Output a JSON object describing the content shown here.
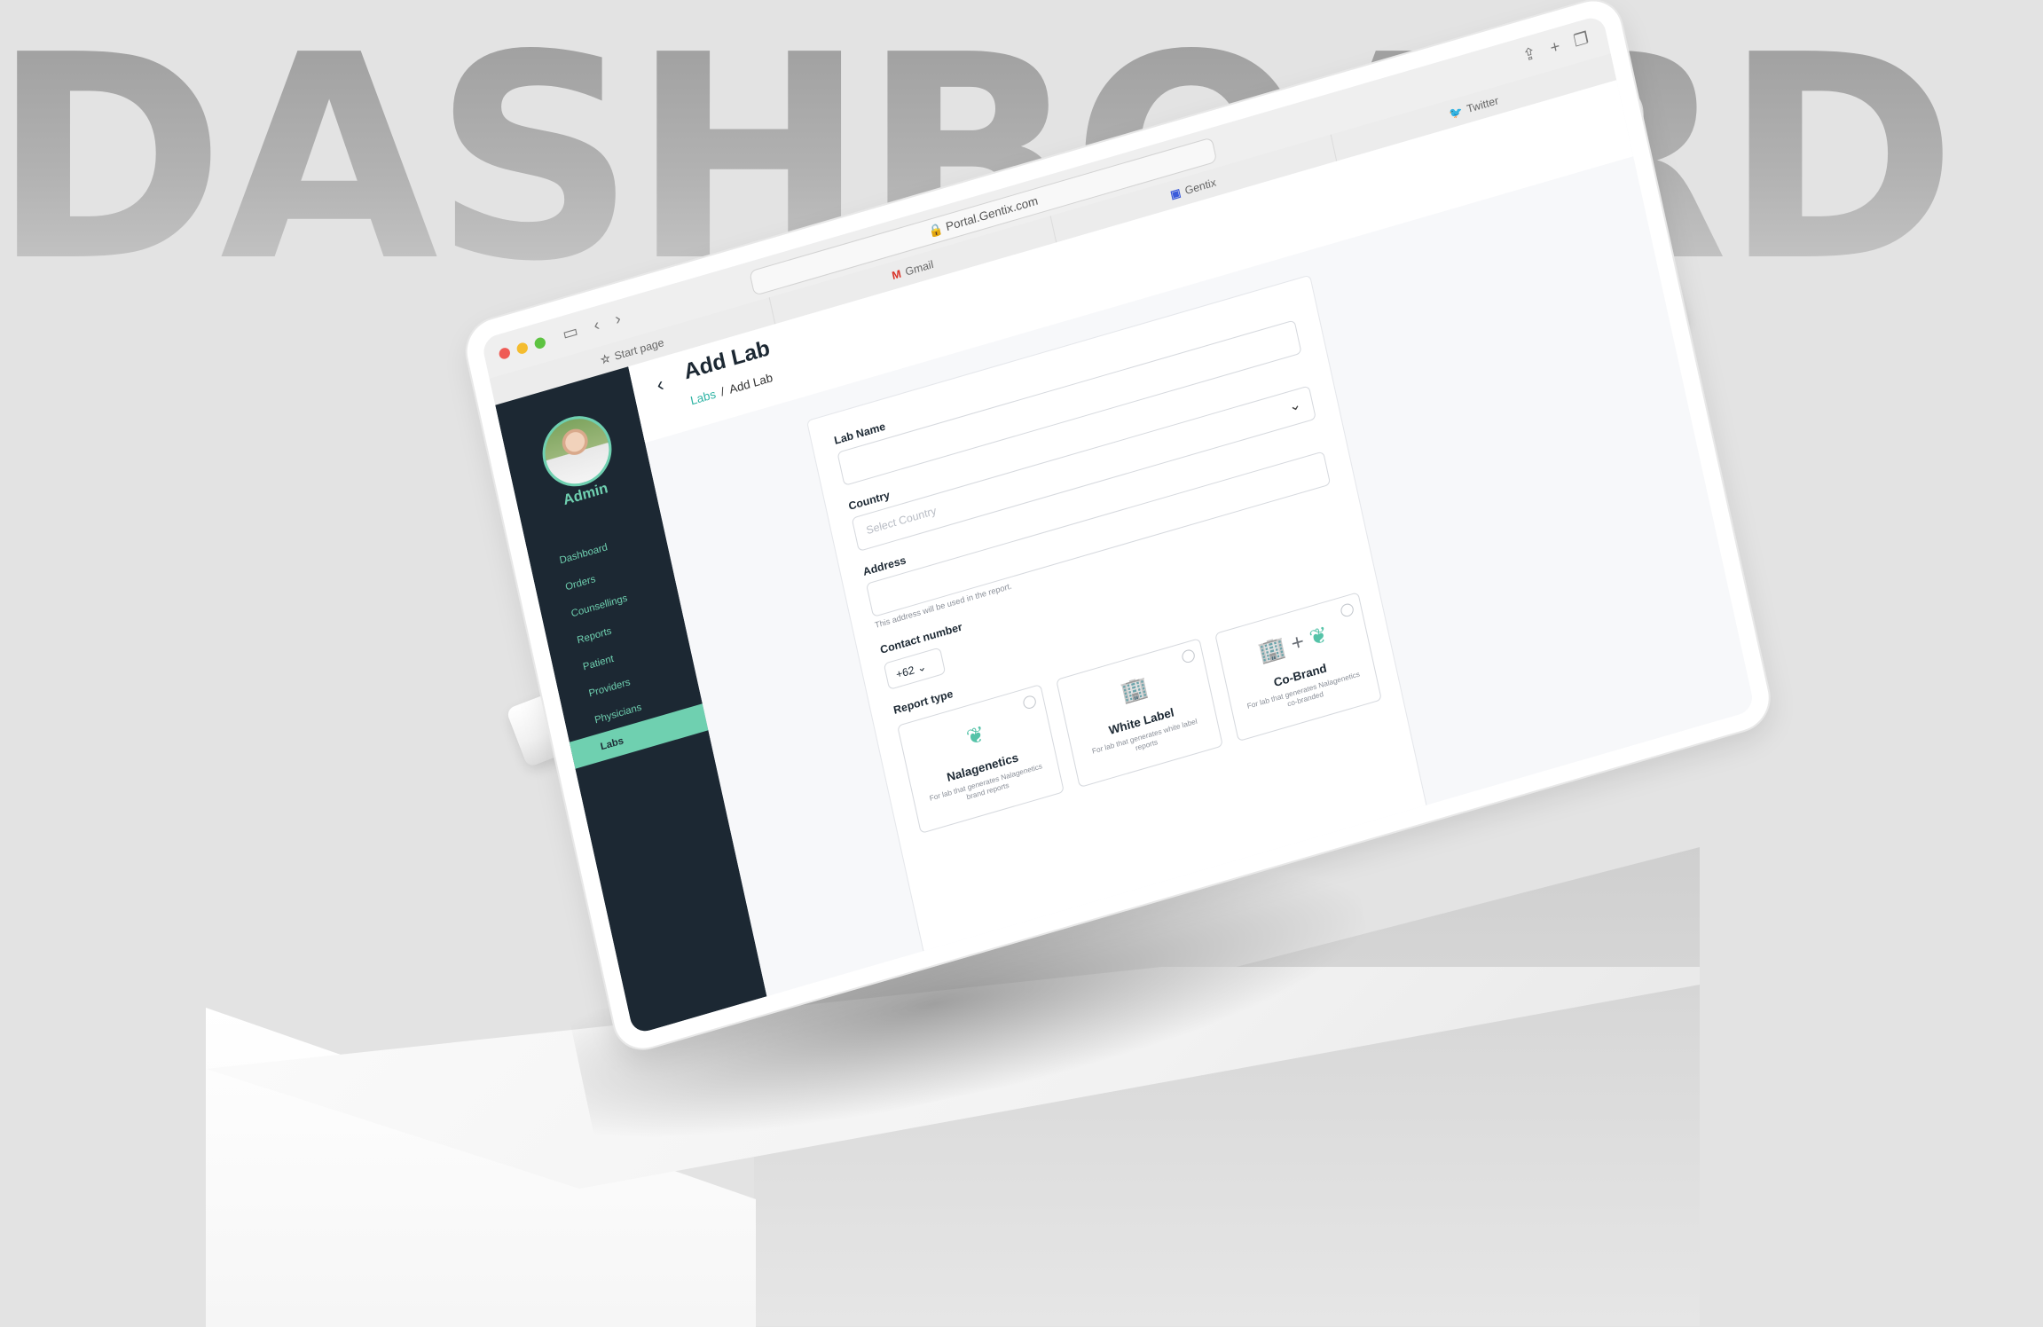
{
  "backdrop": {
    "word": "DASHBOARD"
  },
  "browser": {
    "url": "Portal.Gentix.com",
    "tabs": [
      {
        "label": "Start page",
        "icon": "☆"
      },
      {
        "label": "Gmail",
        "icon": "M"
      },
      {
        "label": "Gentix",
        "icon": "▣"
      },
      {
        "label": "Twitter",
        "icon": "🐦"
      }
    ]
  },
  "sidebar": {
    "user_label": "Admin",
    "items": [
      {
        "label": "Dashboard"
      },
      {
        "label": "Orders"
      },
      {
        "label": "Counsellings"
      },
      {
        "label": "Reports"
      },
      {
        "label": "Patient"
      },
      {
        "label": "Providers"
      },
      {
        "label": "Physicians"
      },
      {
        "label": "Labs"
      }
    ],
    "active_item": "Labs"
  },
  "header": {
    "title": "Add Lab",
    "breadcrumb": {
      "parent": "Labs",
      "separator": "/",
      "current": "Add Lab"
    }
  },
  "form": {
    "lab_name_label": "Lab Name",
    "country_label": "Country",
    "country_placeholder": "Select Country",
    "address_label": "Address",
    "address_help": "This address will be used in the report.",
    "contact_label": "Contact number",
    "country_code": "+62",
    "report_type_label": "Report type",
    "report_types": [
      {
        "title": "Nalagenetics",
        "desc": "For lab that generates Nalagenetics brand reports"
      },
      {
        "title": "White Label",
        "desc": "For lab that generates white label reports"
      },
      {
        "title": "Co-Brand",
        "desc": "For lab that generates Nalagenetics co-branded"
      }
    ]
  },
  "colors": {
    "accent": "#6fd0b0",
    "sidebar_bg": "#1c2833",
    "link": "#2fb3a4"
  }
}
